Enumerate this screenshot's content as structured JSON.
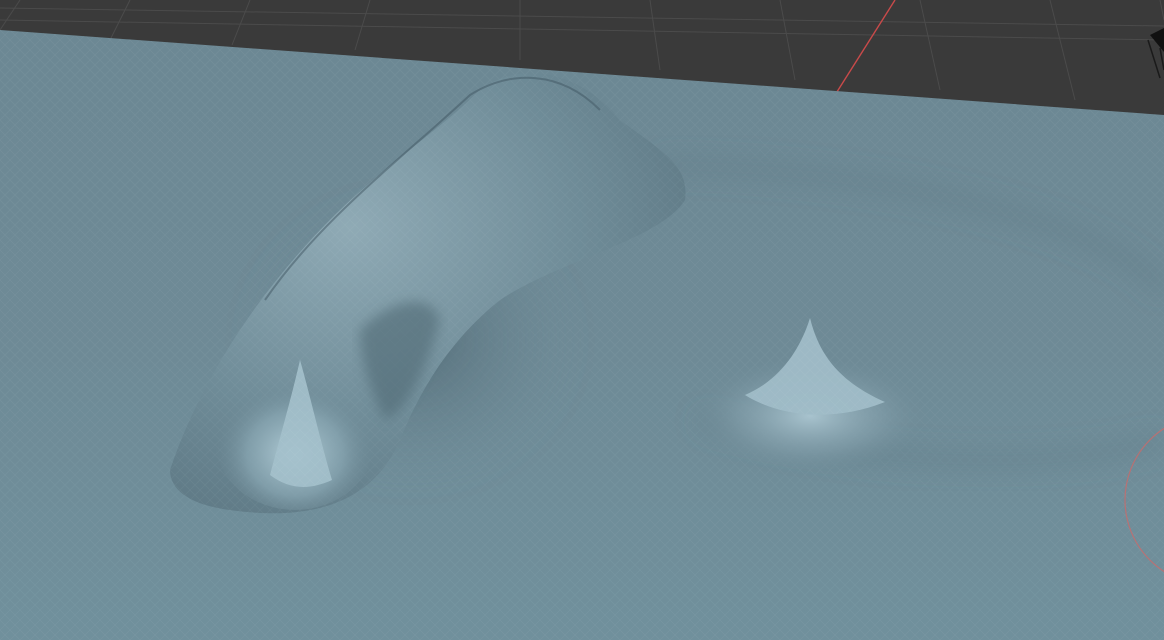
{
  "app": {
    "type": "3d-viewport",
    "background_color": "#3a3a3a",
    "grid_color": "#4a4a4a",
    "x_axis_color": "#c94a4a",
    "surface_color": "#6e8a96",
    "surface_highlight_color": "#a9c6d1",
    "surface_shadow_color": "#56707b"
  },
  "viewport": {
    "mesh_name": "",
    "features": [
      {
        "name": "elongated-ridge",
        "kind": "sculpt-bump"
      },
      {
        "name": "left-spike",
        "kind": "sculpt-spike"
      },
      {
        "name": "right-spike",
        "kind": "sculpt-spike"
      }
    ],
    "gizmos": {
      "camera_icon": "camera-icon",
      "view_navigation_circle": "navigation-circle"
    }
  }
}
